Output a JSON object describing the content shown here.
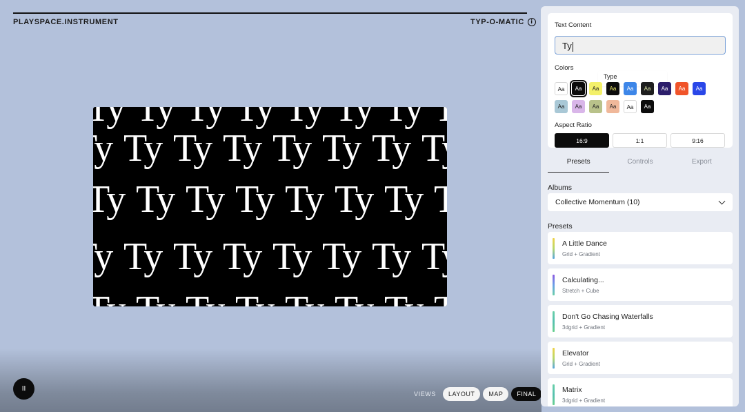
{
  "header": {
    "brand": "PLAYSPACE.INSTRUMENT",
    "app_name": "TYP-O-MATIC",
    "info_icon": "info-icon"
  },
  "canvas": {
    "glyph_text": "Ty",
    "background": "#000000",
    "text_color": "#ffffff"
  },
  "playback": {
    "pause_glyph": "II"
  },
  "views": {
    "label": "VIEWS",
    "options": [
      "LAYOUT",
      "MAP",
      "FINAL"
    ],
    "active": "FINAL"
  },
  "panel": {
    "text_content_label": "Text Content",
    "text_value": "Ty",
    "colors_label": "Colors",
    "tooltip": "Type",
    "swatch_text": "Aa",
    "swatch_row1": [
      {
        "bg": "#ffffff",
        "fg": "#111111"
      },
      {
        "bg": "#0c0c0c",
        "fg": "#ffffff"
      },
      {
        "bg": "#f3f06a",
        "fg": "#222222"
      },
      {
        "bg": "#0c0c0c",
        "fg": "#f3f06a"
      },
      {
        "bg": "#3d86e8",
        "fg": "#ffffff"
      },
      {
        "bg": "#1e1e1e",
        "fg": "#dfe9a8"
      },
      {
        "bg": "#2c1e6b",
        "fg": "#ffffff"
      },
      {
        "bg": "#f0542a",
        "fg": "#ffffff"
      },
      {
        "bg": "#2a47e8",
        "fg": "#ffffff"
      }
    ],
    "swatch_row2": [
      {
        "bg": "#a9c8d6",
        "fg": "#222222"
      },
      {
        "bg": "#d9b6e9",
        "fg": "#222222"
      },
      {
        "bg": "#b9c28a",
        "fg": "#222222"
      },
      {
        "bg": "#f0b89a",
        "fg": "#222222"
      },
      {
        "bg": "#ffffff",
        "fg": "#111111"
      },
      {
        "bg": "#0c0c0c",
        "fg": "#ffffff"
      }
    ],
    "aspect_label": "Aspect Ratio",
    "aspect_options": [
      "16:9",
      "1:1",
      "9:16"
    ],
    "aspect_active": "16:9",
    "tabs": [
      "Presets",
      "Controls",
      "Export"
    ],
    "active_tab": "Presets",
    "albums_label": "Albums",
    "album_selected": "Collective Momentum (10)",
    "presets_label": "Presets",
    "presets": [
      {
        "name": "A Little Dance",
        "sub": "Grid + Gradient",
        "colors": [
          "#f0d24a",
          "#b8d86a",
          "#56a6e0"
        ]
      },
      {
        "name": "Calculating...",
        "sub": "Stretch + Cube",
        "colors": [
          "#8c5ae0",
          "#6aa0e8",
          "#6ad0a8"
        ]
      },
      {
        "name": "Don't Go Chasing Waterfalls",
        "sub": "3dgrid + Gradient",
        "colors": [
          "#6ad0a8",
          "#56c0b0",
          "#6ad090"
        ]
      },
      {
        "name": "Elevator",
        "sub": "Grid + Gradient",
        "colors": [
          "#f0d24a",
          "#b8d86a",
          "#56a6e0"
        ]
      },
      {
        "name": "Matrix",
        "sub": "3dgrid + Gradient",
        "colors": [
          "#6ad0a8",
          "#56c0b0",
          "#6ad090"
        ]
      }
    ]
  }
}
